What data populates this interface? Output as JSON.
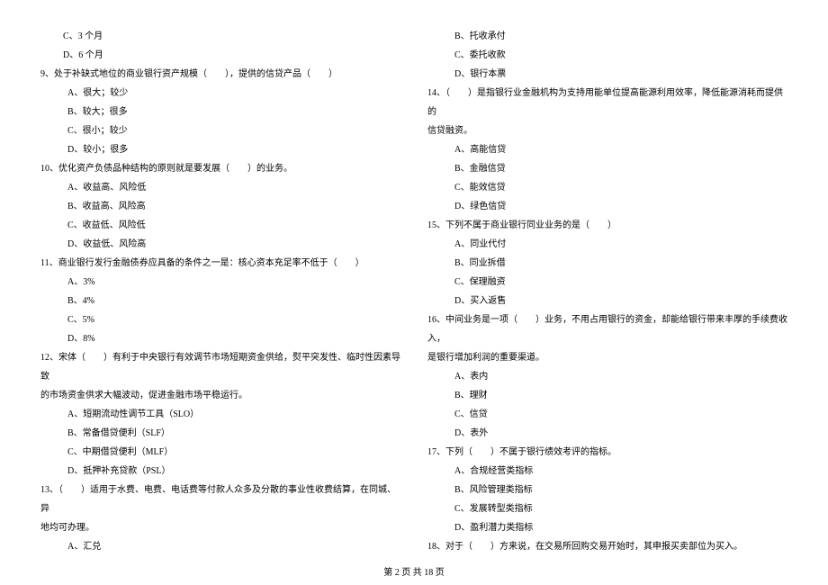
{
  "left": {
    "pre_opts": [
      "C、3 个月",
      "D、6 个月"
    ],
    "q9": {
      "stem": "9、处于补缺式地位的商业银行资产规模（　　），提供的信贷产品（　　）",
      "opts": [
        "A、很大；较少",
        "B、较大；很多",
        "C、很小；较少",
        "D、较小；很多"
      ]
    },
    "q10": {
      "stem": "10、优化资产负债品种结构的原则就是要发展（　　）的业务。",
      "opts": [
        "A、收益高、风险低",
        "B、收益高、风险高",
        "C、收益低、风险低",
        "D、收益低、风险高"
      ]
    },
    "q11": {
      "stem": "11、商业银行发行金融债券应具备的条件之一是：核心资本充足率不低于（　　）",
      "opts": [
        "A、3%",
        "B、4%",
        "C、5%",
        "D、8%"
      ]
    },
    "q12": {
      "stem1": "12、宋体（　　）有利于中央银行有效调节市场短期资金供给，熨平突发性、临时性因素导致",
      "stem2": "的市场资金供求大幅波动，促进金融市场平稳运行。",
      "opts": [
        "A、短期流动性调节工具（SLO）",
        "B、常备借贷便利（SLF）",
        "C、中期借贷便利（MLF）",
        "D、抵押补充贷款（PSL）"
      ]
    },
    "q13": {
      "stem1": "13、（　　）适用于水费、电费、电话费等付款人众多及分散的事业性收费结算，在同城、异",
      "stem2": "地均可办理。",
      "opt_a": "A、汇兑"
    }
  },
  "right": {
    "pre_opts": [
      "B、托收承付",
      "C、委托收款",
      "D、银行本票"
    ],
    "q14": {
      "stem1": "14、（　　）是指银行业金融机构为支持用能单位提高能源利用效率，降低能源消耗而提供的",
      "stem2": "信贷融资。",
      "opts": [
        "A、高能信贷",
        "B、金融信贷",
        "C、能效信贷",
        "D、绿色信贷"
      ]
    },
    "q15": {
      "stem": "15、下列不属于商业银行同业业务的是（　　）",
      "opts": [
        "A、同业代付",
        "B、同业拆借",
        "C、保理融资",
        "D、买入返售"
      ]
    },
    "q16": {
      "stem1": "16、中间业务是一项（　　）业务，不用占用银行的资金，却能给银行带来丰厚的手续费收入，",
      "stem2": "是银行增加利润的重要渠道。",
      "opts": [
        "A、表内",
        "B、理财",
        "C、信贷",
        "D、表外"
      ]
    },
    "q17": {
      "stem": "17、下列（　　）不属于银行绩效考评的指标。",
      "opts": [
        "A、合规经营类指标",
        "B、风险管理类指标",
        "C、发展转型类指标",
        "D、盈利潜力类指标"
      ]
    },
    "q18": {
      "stem": "18、对于（　　）方来说，在交易所回购交易开始时，其申报买卖部位为买入。"
    }
  },
  "footer": "第 2 页 共 18 页"
}
